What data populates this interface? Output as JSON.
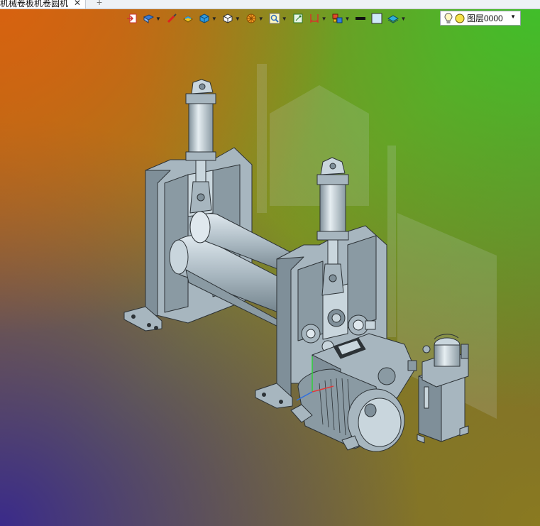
{
  "document_tab": {
    "title": "机械卷板机卷圆机",
    "close_glyph": "✕",
    "new_tab_glyph": "+"
  },
  "toolbar": {
    "tools": [
      {
        "icon": "exit-sketch-icon"
      },
      {
        "icon": "view-orientation-icon",
        "dropdown": true
      },
      {
        "icon": "paint-brush-icon"
      },
      {
        "icon": "color-palette-icon"
      },
      {
        "icon": "render-mode-icon",
        "dropdown": true
      },
      {
        "icon": "standard-view-icon",
        "dropdown": true
      },
      {
        "icon": "section-view-icon",
        "dropdown": true
      },
      {
        "icon": "zoom-fit-icon",
        "dropdown": true
      },
      {
        "icon": "snap-grid-icon"
      },
      {
        "icon": "measure-icon",
        "dropdown": true
      },
      {
        "icon": "assembly-icon",
        "dropdown": true
      },
      {
        "icon": "line-weight-icon"
      },
      {
        "icon": "face-color-icon"
      },
      {
        "icon": "layer-stack-icon",
        "dropdown": true
      }
    ],
    "layer_select": {
      "value": "图层0000",
      "light_icon": "lightbulb-icon",
      "color_icon": "layer-color-icon"
    }
  },
  "colors": {
    "part_fill": "#a7b6bf",
    "part_dark": "#7f8f99",
    "part_light": "#c9d6dd",
    "outline": "#2d3337",
    "accent_orange": "#d8620f",
    "accent_green": "#3fbf2a"
  }
}
